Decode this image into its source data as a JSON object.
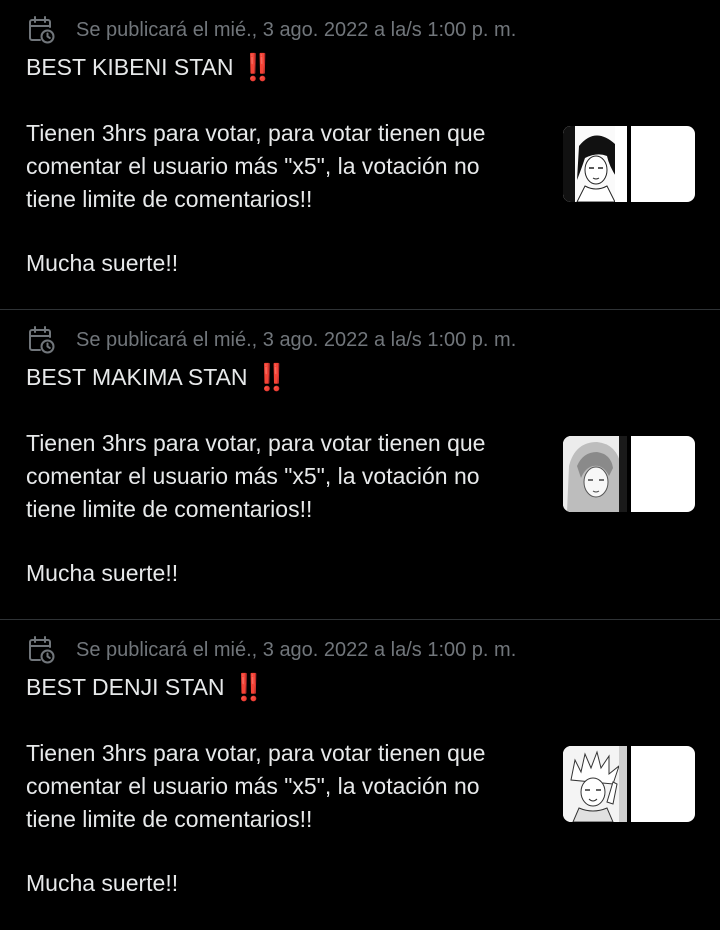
{
  "tweets": [
    {
      "schedule": "Se publicará el mié., 3 ago. 2022 a la/s 1:00 p. m.",
      "title": "BEST KIBENI STAN",
      "emoji": "‼️",
      "body": "Tienen 3hrs para votar, para votar tienen que\ncomentar el usuario más \"x5\", la votación no\ntiene limite de comentarios!!",
      "closing": "Mucha suerte!!"
    },
    {
      "schedule": "Se publicará el mié., 3 ago. 2022 a la/s 1:00 p. m.",
      "title": "BEST MAKIMA STAN",
      "emoji": "‼️",
      "body": "Tienen 3hrs para votar, para votar tienen que\ncomentar el usuario más \"x5\", la votación no\ntiene limite de comentarios!!",
      "closing": "Mucha suerte!!"
    },
    {
      "schedule": "Se publicará el mié., 3 ago. 2022 a la/s 1:00 p. m.",
      "title": "BEST DENJI STAN",
      "emoji": "‼️",
      "body": "Tienen 3hrs para votar, para votar tienen que\ncomentar el usuario más \"x5\", la votación no\ntiene limite de comentarios!!",
      "closing": "Mucha suerte!!"
    }
  ],
  "icons": {
    "schedule": "calendar-clock-icon"
  },
  "colors": {
    "background": "#000000",
    "text": "#e7e9ea",
    "muted": "#71767b",
    "divider": "#2f3336",
    "emoji": "#e0245e"
  }
}
